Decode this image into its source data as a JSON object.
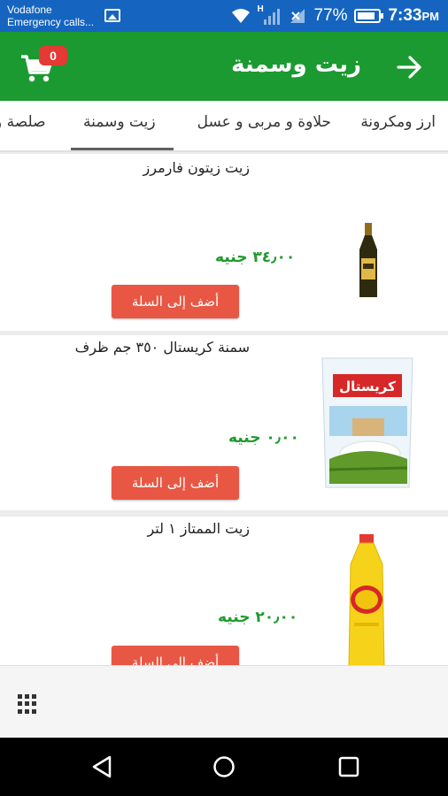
{
  "status_bar": {
    "carrier": "Vodafone",
    "carrier_sub": "Emergency calls...",
    "network_type": "H",
    "battery": "77%",
    "time": "7:33",
    "time_suffix": "PM"
  },
  "toolbar": {
    "title": "زيت وسمنة",
    "cart_count": "0",
    "back_icon": "arrow-right-icon",
    "cart_icon": "cart-icon"
  },
  "tabs": [
    {
      "label": "ارز ومكرونة",
      "active": false
    },
    {
      "label": "حلاوة و مربى و عسل",
      "active": false
    },
    {
      "label": "زيت وسمنة",
      "active": true
    },
    {
      "label": "صلصة و",
      "active": false
    }
  ],
  "products": [
    {
      "name": "زيت زيتون فارمرز",
      "price": "٣٤٫٠٠ جنيه",
      "button": "أضف إلى السلة",
      "image_icon": "olive-oil-bottle-icon"
    },
    {
      "name": "سمنة كريستال ٣٥٠ جم ظرف",
      "price": "٠٫٠٠ جنيه",
      "button": "أضف إلى السلة",
      "image_icon": "crystal-ghee-pack-icon",
      "image_text": "كريستال"
    },
    {
      "name": "زيت الممتاز ١ لتر",
      "price": "٢٠٫٠٠ جنيه",
      "button": "أضف إلى السلة",
      "image_icon": "oil-bottle-icon"
    }
  ],
  "bottom_bar": {
    "icon": "grid-menu-icon"
  },
  "nav_bar": {
    "back": "nav-back-icon",
    "home": "nav-home-icon",
    "recents": "nav-recents-icon"
  },
  "colors": {
    "status_bar": "#1565c0",
    "toolbar": "#1b9a31",
    "badge": "#e53935",
    "price": "#1e9a2c",
    "add_button": "#e85744"
  }
}
